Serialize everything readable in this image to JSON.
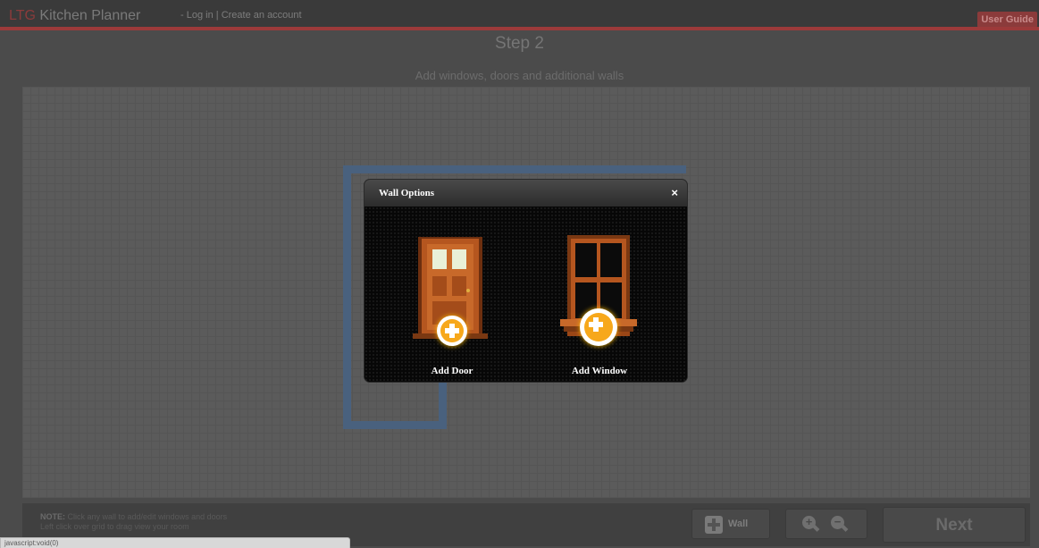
{
  "header": {
    "brand_prefix": "LTG",
    "brand_name": "Kitchen Planner",
    "separator": " - ",
    "login": "Log in",
    "divider": " | ",
    "create_account": "Create an account",
    "user_guide": "User Guide"
  },
  "step": {
    "title": "Step 2",
    "subtitle": "Add windows, doors and additional walls"
  },
  "modal": {
    "title": "Wall Options",
    "close": "×",
    "options": [
      {
        "label": "Add Door",
        "icon": "door-icon"
      },
      {
        "label": "Add Window",
        "icon": "window-icon"
      }
    ]
  },
  "footer": {
    "note_label": "NOTE:",
    "note_line1": "Click any wall to add/edit windows and doors",
    "note_line2": "Left click over grid to drag view your room",
    "wall_button": "Wall",
    "zoom_in": "+",
    "zoom_out": "−",
    "next_button": "Next"
  },
  "statusbar": {
    "text": "javascript:void(0)"
  },
  "colors": {
    "accent_red": "#8b3b3b",
    "wall_blue": "#49617e",
    "plus_orange": "#f7a81b",
    "wood": "#b5561f"
  }
}
